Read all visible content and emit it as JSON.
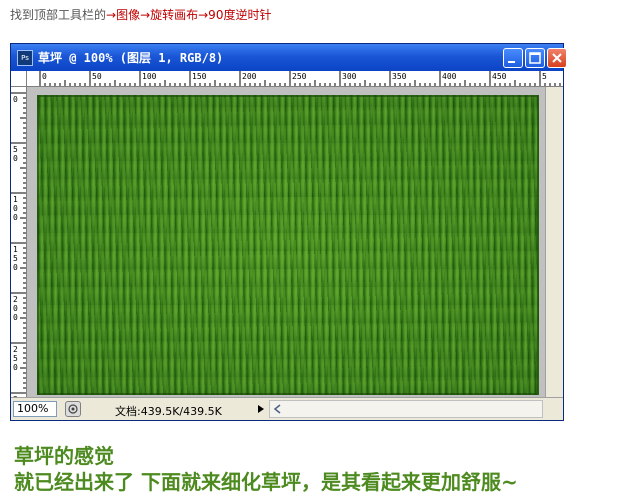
{
  "instruction": {
    "prefix": "找到顶部工具栏的",
    "steps": "→图像→旋转画布→90度逆时针"
  },
  "window": {
    "title": "草坪 @ 100% (图层 1, RGB/8)",
    "app_icon": "Ps",
    "buttons": [
      "minimize-icon",
      "maximize-icon",
      "close-icon"
    ]
  },
  "ruler": {
    "h_labels": [
      "0",
      "50",
      "100",
      "150",
      "200",
      "250",
      "300",
      "350",
      "400",
      "450",
      "5"
    ],
    "v_labels": [
      "0",
      "50",
      "100",
      "150",
      "200",
      "250",
      "3"
    ]
  },
  "status": {
    "zoom": "100%",
    "doc_info": "文档:439.5K/439.5K"
  },
  "caption": {
    "line1": "草坪的感觉",
    "line2": "就已经出来了 下面就来细化草坪，是其看起来更加舒服~"
  },
  "colors": {
    "caption": "#4d8a1f",
    "steps": "#c00000",
    "grass": "#3d8a1c",
    "titlebar": "#1a56d6"
  }
}
